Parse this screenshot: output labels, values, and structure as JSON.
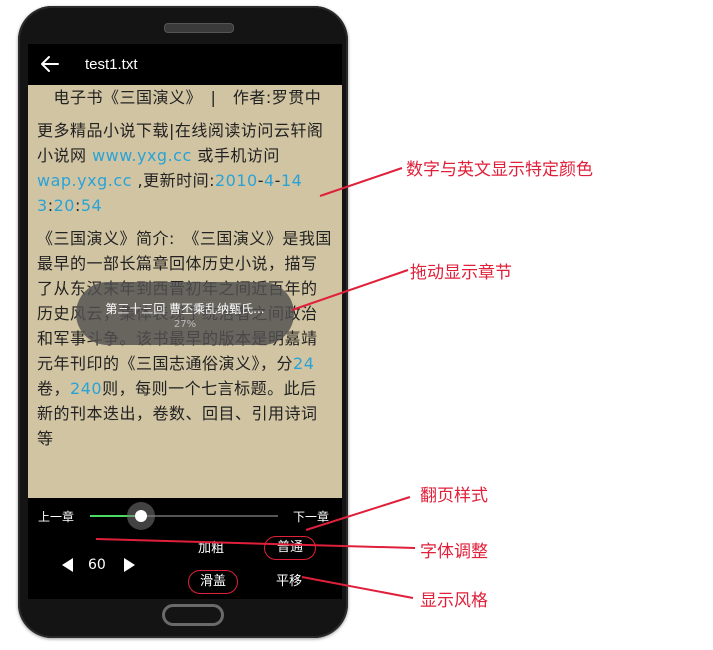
{
  "app": {
    "title": "test1.txt"
  },
  "reader": {
    "paragraphs": [
      [
        "　电子书《三国演义》　|　作者:罗贯中"
      ],
      [
        {
          "t": "更多精品小说下载|在线阅读访问云轩阁小说网 "
        },
        {
          "t": "www.yxg.cc",
          "hl": true
        },
        {
          "t": " 或手机访问 "
        },
        {
          "t": "wap.yxg.cc",
          "hl": true
        },
        {
          "t": " ,更新时间:"
        },
        {
          "t": "2010",
          "hl": true
        },
        {
          "t": "-"
        },
        {
          "t": "4",
          "hl": true
        },
        {
          "t": "-"
        },
        {
          "t": "14",
          "hl": true
        },
        {
          "t": " "
        },
        {
          "t": "3",
          "hl": true
        },
        {
          "t": ":"
        },
        {
          "t": "20",
          "hl": true
        },
        {
          "t": ":"
        },
        {
          "t": "54",
          "hl": true
        }
      ],
      [
        {
          "t": "《三国演义》简介:　《三国演义》是我国最早的一部长篇章回体历史小说，描写了从东汉末年到西晋初年之间近百年的历史风云，集体表现了统治者之间政治和军事斗争。该书最早的版本是明嘉靖元年刊印的《三国志通俗演义》，分"
        },
        {
          "t": "24",
          "hl": true
        },
        {
          "t": "卷，"
        },
        {
          "t": "240",
          "hl": true
        },
        {
          "t": "则，每则一个七言标题。此后新的刊本迭出，卷数、回目、引用诗词等"
        }
      ]
    ],
    "highlight_color": "#29a3d6",
    "background_color": "#d1c4a3"
  },
  "toast": {
    "chapter": "第三十三回 曹丕乘乱纳甄氏...",
    "percent": "27%"
  },
  "controls": {
    "prev_chapter": "上一章",
    "next_chapter": "下一章",
    "progress": 0.27,
    "font_size": "60",
    "bold_label": "加粗",
    "normal_label": "普通",
    "slide_label": "滑盖",
    "shift_label": "平移",
    "swatches": [
      "#cfc9bd",
      "#c8e6c9",
      "#d1c4a3",
      "#3b3632",
      "#0c1a24"
    ]
  },
  "annotations": {
    "color_note": "数字与英文显示特定颜色",
    "drag_note": "拖动显示章节",
    "page_style_note": "翻页样式",
    "font_note": "字体调整",
    "theme_note": "显示风格",
    "color": "#e0203a"
  }
}
